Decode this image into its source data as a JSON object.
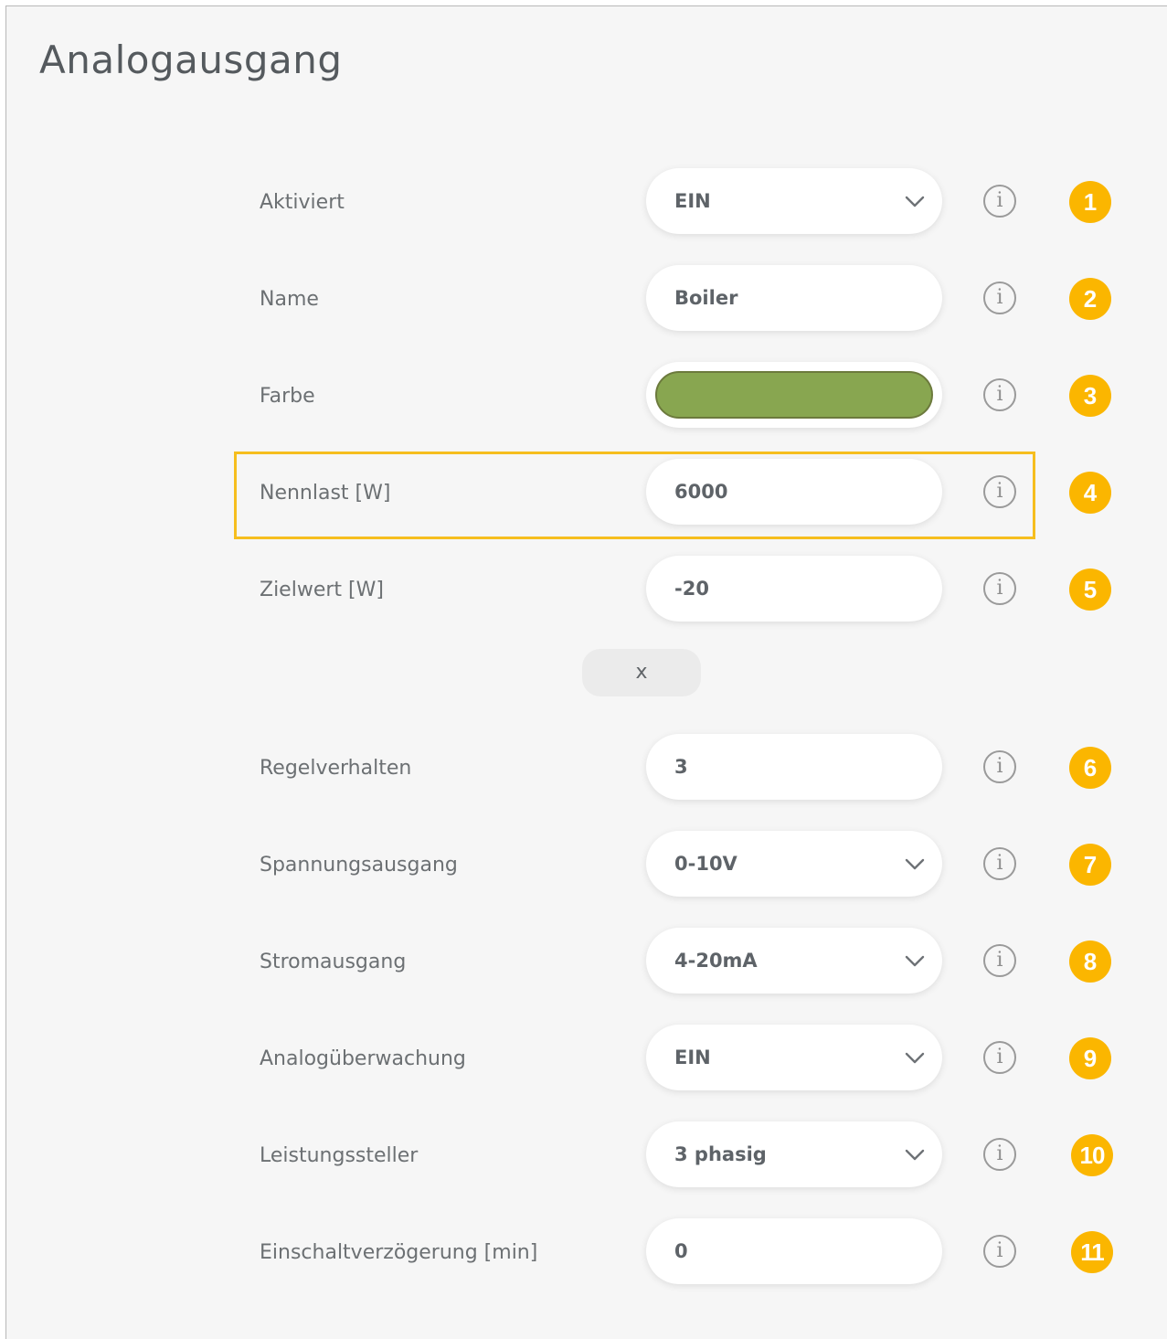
{
  "page": {
    "title": "Analogausgang"
  },
  "fields": [
    {
      "label": "Aktiviert",
      "value": "EIN",
      "type": "select",
      "badge": "1"
    },
    {
      "label": "Name",
      "value": "Boiler",
      "type": "text",
      "badge": "2"
    },
    {
      "label": "Farbe",
      "type": "color",
      "color": "#88a650",
      "badge": "3"
    },
    {
      "label": "Nennlast [W]",
      "value": "6000",
      "type": "text",
      "badge": "4",
      "highlighted": true
    },
    {
      "label": "Zielwert [W]",
      "value": "-20",
      "type": "text",
      "badge": "5"
    },
    {
      "label": "Regelverhalten",
      "value": "3",
      "type": "text",
      "badge": "6"
    },
    {
      "label": "Spannungsausgang",
      "value": "0-10V",
      "type": "select",
      "badge": "7"
    },
    {
      "label": "Stromausgang",
      "value": "4-20mA",
      "type": "select",
      "badge": "8"
    },
    {
      "label": "Analogüberwachung",
      "value": "EIN",
      "type": "select",
      "badge": "9"
    },
    {
      "label": "Leistungssteller",
      "value": "3 phasig",
      "type": "select",
      "badge": "10"
    },
    {
      "label": "Einschaltverzögerung [min]",
      "value": "0",
      "type": "text",
      "badge": "11"
    }
  ],
  "x_button": {
    "label": "x"
  },
  "icons": {
    "info": "info-icon",
    "dropdown": "chevron-down-icon"
  },
  "colors": {
    "badge": "#fbb600",
    "highlight": "#f6be1e",
    "accent_green": "#88a650"
  },
  "info_glyph": "i"
}
